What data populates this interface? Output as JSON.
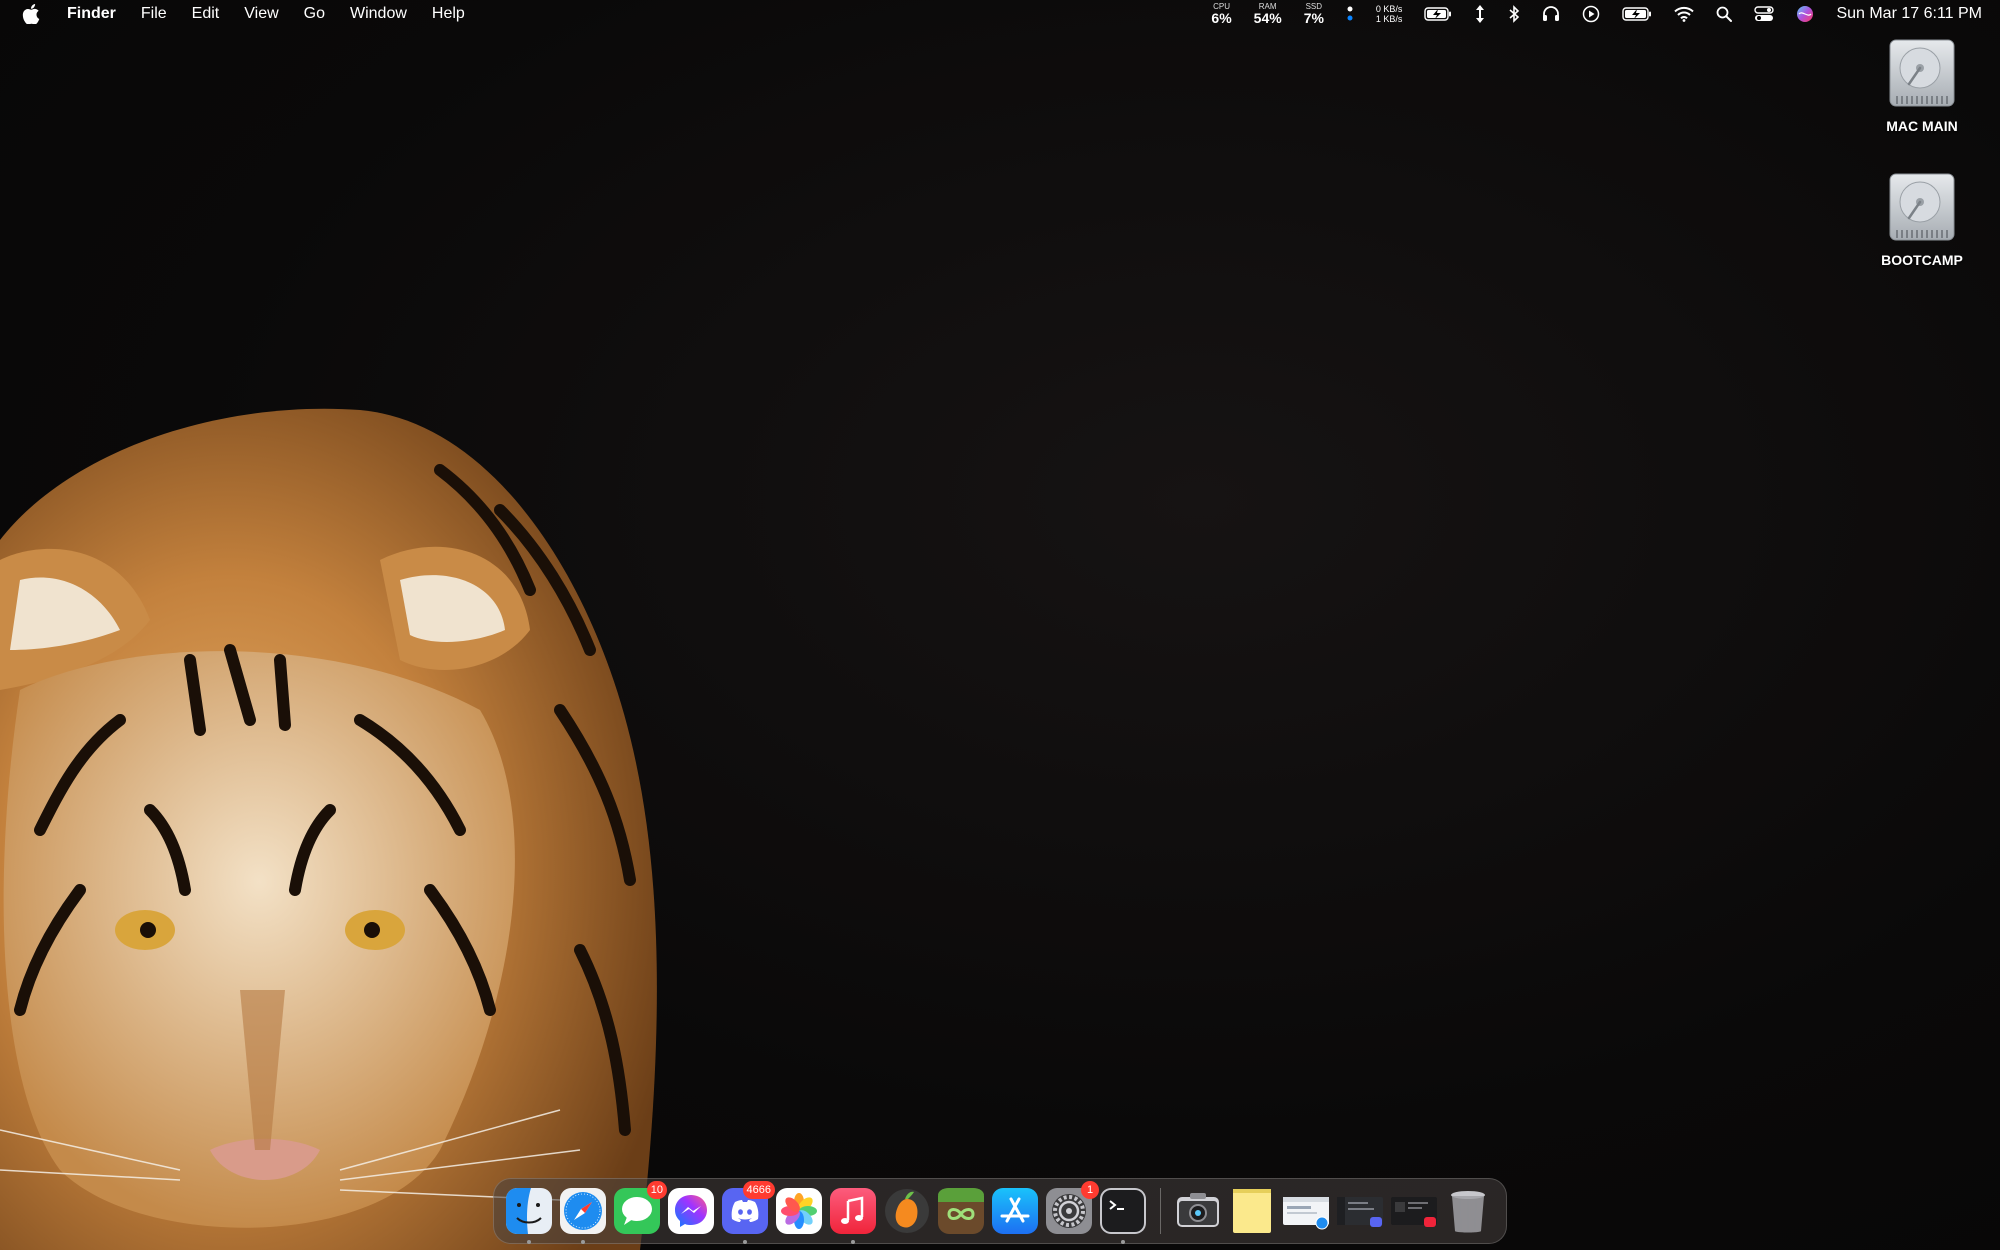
{
  "menubar": {
    "app_name": "Finder",
    "menus": [
      "File",
      "Edit",
      "View",
      "Go",
      "Window",
      "Help"
    ],
    "stats": [
      {
        "label": "CPU",
        "value": "6%"
      },
      {
        "label": "RAM",
        "value": "54%"
      },
      {
        "label": "SSD",
        "value": "7%"
      }
    ],
    "network": {
      "down": "0 KB/s",
      "up": "1 KB/s"
    },
    "clock": "Sun Mar 17  6:11 PM"
  },
  "desktop": {
    "icons": [
      {
        "label": "MAC MAIN",
        "icon": "hard-drive-icon"
      },
      {
        "label": "BOOTCAMP",
        "icon": "hard-drive-icon"
      }
    ]
  },
  "dock": {
    "apps": [
      {
        "name": "finder",
        "running": true
      },
      {
        "name": "safari",
        "running": true
      },
      {
        "name": "messages",
        "badge": "10"
      },
      {
        "name": "messenger"
      },
      {
        "name": "discord",
        "badge": "4666",
        "running": true
      },
      {
        "name": "photos"
      },
      {
        "name": "music",
        "running": true
      },
      {
        "name": "fl-studio"
      },
      {
        "name": "minecraft"
      },
      {
        "name": "app-store"
      },
      {
        "name": "system-settings",
        "badge": "1"
      },
      {
        "name": "terminal",
        "running": true
      }
    ]
  },
  "colors": {
    "badge": "#ff3b30",
    "accent": "#0a84ff",
    "desktop": "#0b0a0a"
  }
}
